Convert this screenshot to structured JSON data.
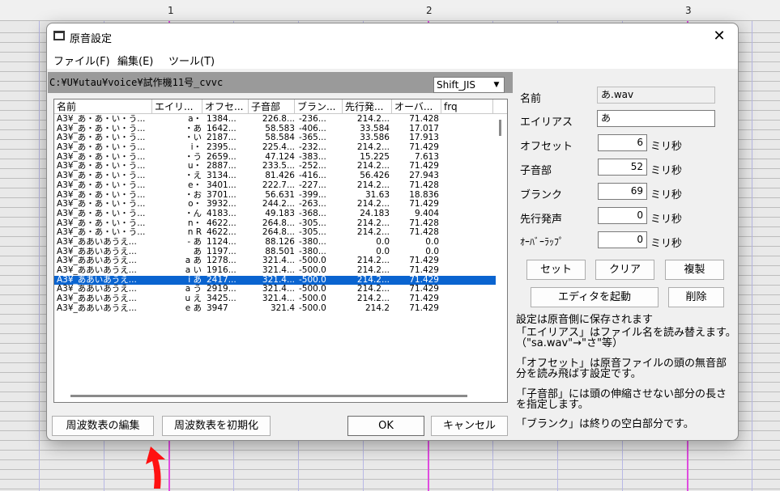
{
  "ruler": [
    "1",
    "2",
    "3"
  ],
  "dialog": {
    "title": "原音設定",
    "close": "✕",
    "menu": [
      "ファイル(F)",
      "編集(E)",
      "ツール(T)"
    ],
    "path": "C:¥U¥utau¥voice¥試作機11号_cvvc",
    "encoding": "Shift_JIS",
    "encoding_arrow": "▼"
  },
  "table": {
    "columns": [
      "名前",
      "エイリ...",
      "オフセ...",
      "子音部",
      "ブラン...",
      "先行発...",
      "オーバ...",
      "frq"
    ],
    "selected_index": 17,
    "rows": [
      [
        "A3¥_あ・あ・い・う...",
        "a・",
        "1384...",
        "226.8...",
        "-236...",
        "214.2...",
        "71.428",
        ""
      ],
      [
        "A3¥_あ・あ・い・う...",
        "・あ",
        "1642...",
        "58.583",
        "-406...",
        "33.584",
        "17.017",
        ""
      ],
      [
        "A3¥_あ・あ・い・う...",
        "・い",
        "2187...",
        "58.584",
        "-365...",
        "33.586",
        "17.913",
        ""
      ],
      [
        "A3¥_あ・あ・い・う...",
        "i・",
        "2395...",
        "225.4...",
        "-232...",
        "214.2...",
        "71.429",
        ""
      ],
      [
        "A3¥_あ・あ・い・う...",
        "・う",
        "2659...",
        "47.124",
        "-383...",
        "15.225",
        "7.613",
        ""
      ],
      [
        "A3¥_あ・あ・い・う...",
        "u・",
        "2887...",
        "233.5...",
        "-252...",
        "214.2...",
        "71.429",
        ""
      ],
      [
        "A3¥_あ・あ・い・う...",
        "・え",
        "3134...",
        "81.426",
        "-416...",
        "56.426",
        "27.943",
        ""
      ],
      [
        "A3¥_あ・あ・い・う...",
        "e・",
        "3401...",
        "222.7...",
        "-227...",
        "214.2...",
        "71.428",
        ""
      ],
      [
        "A3¥_あ・あ・い・う...",
        "・お",
        "3701...",
        "56.631",
        "-399...",
        "31.63",
        "18.836",
        ""
      ],
      [
        "A3¥_あ・あ・い・う...",
        "o・",
        "3932...",
        "244.2...",
        "-263...",
        "214.2...",
        "71.429",
        ""
      ],
      [
        "A3¥_あ・あ・い・う...",
        "・ん",
        "4183...",
        "49.183",
        "-368...",
        "24.183",
        "9.404",
        ""
      ],
      [
        "A3¥_あ・あ・い・う...",
        "n・",
        "4622...",
        "264.8...",
        "-305...",
        "214.2...",
        "71.428",
        ""
      ],
      [
        "A3¥_あ・あ・い・う...",
        "n R",
        "4622...",
        "264.8...",
        "-305...",
        "214.2...",
        "71.428",
        ""
      ],
      [
        "A3¥_ああいあうえ...",
        "- あ",
        "1124...",
        "88.126",
        "-380...",
        "0.0",
        "0.0",
        ""
      ],
      [
        "A3¥_ああいあうえ...",
        "あ",
        "1197...",
        "88.501",
        "-380...",
        "0.0",
        "0.0",
        ""
      ],
      [
        "A3¥_ああいあうえ...",
        "a あ",
        "1278...",
        "321.4...",
        "-500.0",
        "214.2...",
        "71.429",
        ""
      ],
      [
        "A3¥_ああいあうえ...",
        "a い",
        "1916...",
        "321.4...",
        "-500.0",
        "214.2...",
        "71.429",
        ""
      ],
      [
        "A3¥_ああいあうえ...",
        "i あ",
        "2417...",
        "321.4...",
        "-500.0",
        "214.2...",
        "71.429",
        ""
      ],
      [
        "A3¥_ああいあうえ...",
        "a う",
        "2919...",
        "321.4...",
        "-500.0",
        "214.2...",
        "71.429",
        ""
      ],
      [
        "A3¥_ああいあうえ...",
        "u え",
        "3425...",
        "321.4...",
        "-500.0",
        "214.2...",
        "71.429",
        ""
      ],
      [
        "A3¥_ああいあうえ...",
        "e あ",
        "3947",
        "321.4",
        "-500.0",
        "214.2",
        "71.429",
        ""
      ]
    ]
  },
  "buttons": {
    "edit_freq": "周波数表の編集",
    "init_freq": "周波数表を初期化",
    "ok": "OK",
    "cancel": "キャンセル",
    "set": "セット",
    "clear": "クリア",
    "duplicate": "複製",
    "launch_editor": "エディタを起動",
    "delete": "削除"
  },
  "fields": {
    "name_label": "名前",
    "name_value": "あ.wav",
    "alias_label": "エイリアス",
    "alias_value": "あ",
    "offset_label": "オフセット",
    "offset_value": "6",
    "consonant_label": "子音部",
    "consonant_value": "52",
    "blank_label": "ブランク",
    "blank_value": "69",
    "preutter_label": "先行発声",
    "preutter_value": "0",
    "overlap_label": "ｵｰﾊﾞｰﾗｯﾌﾟ",
    "overlap_value": "0",
    "unit": "ミリ秒"
  },
  "notes": [
    "設定は原音側に保存されます",
    "「エイリアス」はファイル名を読み替えます。（\"sa.wav\"→\"さ\"等）",
    "「オフセット」は原音ファイルの頭の無音部分を読み飛ばす設定です。",
    "「子音部」には頭の伸縮させない部分の長さを指定します。",
    "「ブランク」は終りの空白部分です。"
  ],
  "colors": {
    "selection": "#0a64d0",
    "annotation_arrow": "#ff1010"
  }
}
